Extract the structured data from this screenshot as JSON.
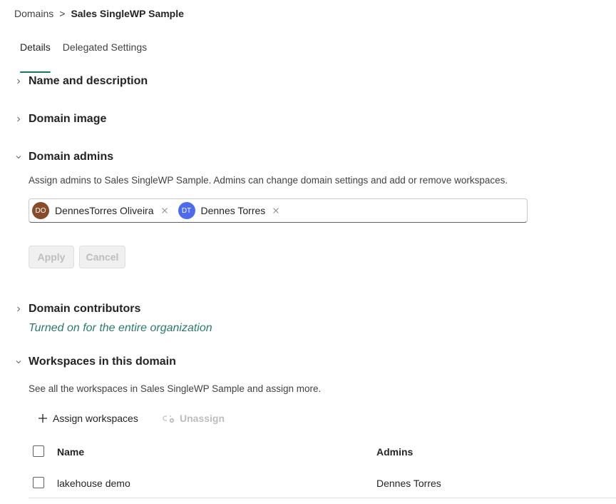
{
  "breadcrumb": {
    "root": "Domains",
    "separator": ">",
    "current": "Sales SingleWP Sample"
  },
  "tabs": [
    {
      "label": "Details",
      "active": true
    },
    {
      "label": "Delegated Settings",
      "active": false
    }
  ],
  "sections": {
    "name_description": {
      "title": "Name and description",
      "expanded": false
    },
    "domain_image": {
      "title": "Domain image",
      "expanded": false
    },
    "domain_admins": {
      "title": "Domain admins",
      "expanded": true,
      "description": "Assign admins to Sales SingleWP Sample. Admins can change domain settings and add or remove workspaces.",
      "admins": [
        {
          "initials": "DO",
          "name": "DennesTorres Oliveira",
          "color": "#8a4b2a"
        },
        {
          "initials": "DT",
          "name": "Dennes Torres",
          "color": "#4f6bed"
        }
      ],
      "apply_label": "Apply",
      "cancel_label": "Cancel"
    },
    "domain_contributors": {
      "title": "Domain contributors",
      "expanded": false,
      "status": "Turned on for the entire organization"
    },
    "workspaces": {
      "title": "Workspaces in this domain",
      "expanded": true,
      "description": "See all the workspaces in Sales SingleWP Sample and assign more.",
      "assign_label": "Assign workspaces",
      "unassign_label": "Unassign",
      "columns": [
        "Name",
        "Admins"
      ],
      "rows": [
        {
          "name": "lakehouse demo",
          "admins": "Dennes Torres"
        }
      ]
    }
  },
  "colors": {
    "accent": "#117865",
    "status_text": "#2b7a6a",
    "disabled_text": "#bdbdbd"
  }
}
